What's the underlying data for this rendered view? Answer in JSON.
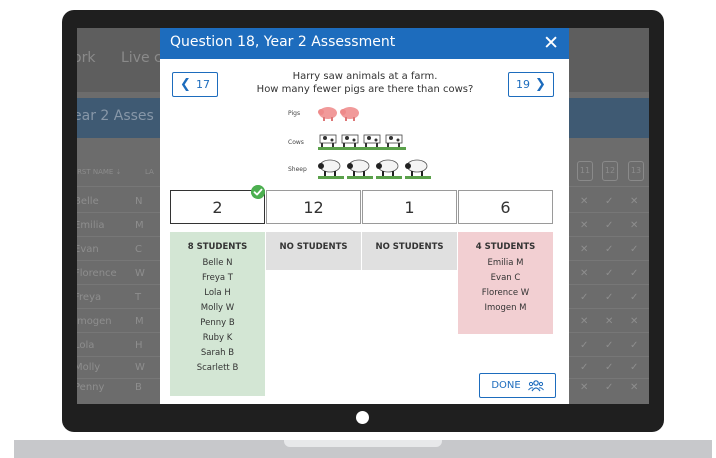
{
  "background_app": {
    "tabs": [
      "ork",
      "Live c"
    ],
    "title": "ear 2 Asses",
    "column_header": "IRST NAME",
    "column_header_2": "LA",
    "question_numbers": [
      "11",
      "12",
      "13"
    ],
    "rows": [
      {
        "name": "Belle",
        "initial": "N"
      },
      {
        "name": "Emilia",
        "initial": "M"
      },
      {
        "name": "Evan",
        "initial": "C"
      },
      {
        "name": "Florence",
        "initial": "W"
      },
      {
        "name": "Freya",
        "initial": "T"
      },
      {
        "name": "Imogen",
        "initial": "M"
      },
      {
        "name": "Lola",
        "initial": "H"
      },
      {
        "name": "Molly",
        "initial": "W"
      },
      {
        "name": "Penny",
        "initial": "B"
      }
    ]
  },
  "modal": {
    "title": "Question 18, Year 2 Assessment",
    "prev_label": "17",
    "next_label": "19",
    "question_line1": "Harry saw animals at a farm.",
    "question_line2": "How many fewer pigs are there than cows?",
    "picture": {
      "labels": [
        "Pigs",
        "Cows",
        "Sheep"
      ],
      "counts": [
        2,
        4,
        4
      ]
    },
    "answers": [
      {
        "value": "2",
        "correct": true
      },
      {
        "value": "12",
        "correct": false
      },
      {
        "value": "1",
        "correct": false
      },
      {
        "value": "6",
        "correct": false
      }
    ],
    "panels": [
      {
        "heading": "8 STUDENTS",
        "students": [
          "Belle N",
          "Freya T",
          "Lola H",
          "Molly W",
          "Penny B",
          "Ruby K",
          "Sarah B",
          "Scarlett B"
        ]
      },
      {
        "heading": "NO STUDENTS",
        "students": []
      },
      {
        "heading": "NO STUDENTS",
        "students": []
      },
      {
        "heading": "4 STUDENTS",
        "students": [
          "Emilia M",
          "Evan C",
          "Florence W",
          "Imogen M"
        ]
      }
    ],
    "done_label": "DONE"
  },
  "colors": {
    "accent": "#1d6cbd",
    "correct": "#4caf50",
    "correct_panel": "#d3e6d4",
    "wrong_panel": "#f2cfd2",
    "empty_panel": "#e0e0e0"
  },
  "icons": [
    "close-icon",
    "chevron-left-icon",
    "chevron-right-icon",
    "check-icon",
    "group-icon"
  ]
}
